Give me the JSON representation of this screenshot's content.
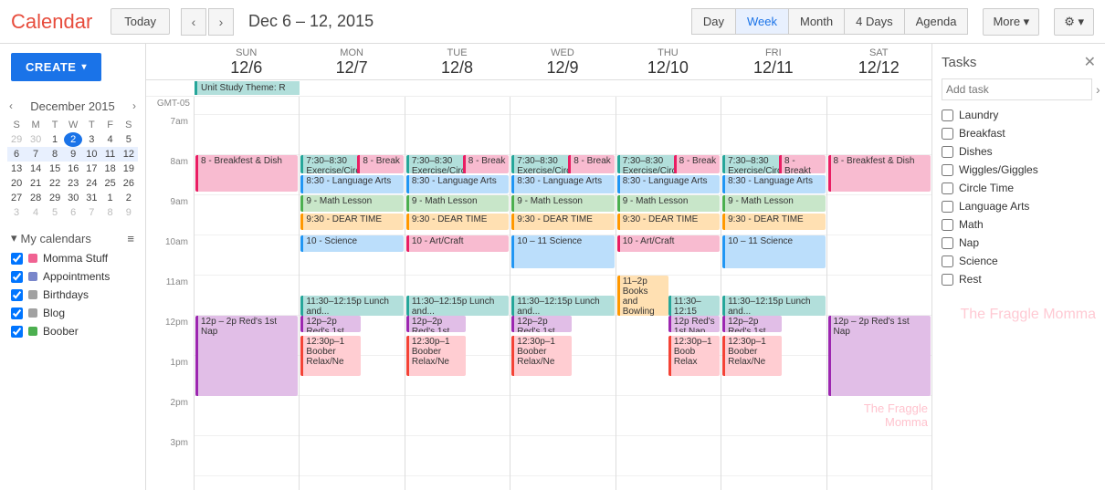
{
  "topbar": {
    "title": "Calendar",
    "today_label": "Today",
    "date_range": "Dec 6 – 12, 2015",
    "nav_prev": "‹",
    "nav_next": "›",
    "views": [
      "Day",
      "Week",
      "Month",
      "4 Days",
      "Agenda"
    ],
    "active_view": "Week",
    "more_label": "More",
    "gear_label": "⚙"
  },
  "sidebar": {
    "create_label": "CREATE",
    "mini_cal": {
      "title": "December 2015",
      "days_header": [
        "S",
        "M",
        "T",
        "W",
        "T",
        "F",
        "S"
      ],
      "weeks": [
        [
          "29",
          "30",
          "1",
          "2",
          "3",
          "4",
          "5"
        ],
        [
          "6",
          "7",
          "8",
          "9",
          "10",
          "11",
          "12"
        ],
        [
          "13",
          "14",
          "15",
          "16",
          "17",
          "18",
          "19"
        ],
        [
          "20",
          "21",
          "22",
          "23",
          "24",
          "25",
          "26"
        ],
        [
          "27",
          "28",
          "29",
          "30",
          "31",
          "1",
          "2"
        ],
        [
          "3",
          "4",
          "5",
          "6",
          "7",
          "8",
          "9"
        ]
      ],
      "today": "2",
      "selected_week": [
        "6",
        "7",
        "8",
        "9",
        "10",
        "11",
        "12"
      ]
    },
    "my_calendars_label": "My calendars",
    "calendars": [
      {
        "name": "Momma Stuff",
        "color": "#f06292"
      },
      {
        "name": "Appointments",
        "color": "#7986cb"
      },
      {
        "name": "Birthdays",
        "color": "#a1a1a1"
      },
      {
        "name": "Blog",
        "color": "#a1a1a1"
      },
      {
        "name": "Boober",
        "color": "#4caf50"
      }
    ]
  },
  "calendar": {
    "gmt_label": "GMT-05",
    "days": [
      {
        "day": "Sun",
        "date": "12/6"
      },
      {
        "day": "Mon",
        "date": "12/7"
      },
      {
        "day": "Tue",
        "date": "12/8"
      },
      {
        "day": "Wed",
        "date": "12/9"
      },
      {
        "day": "Thu",
        "date": "12/10"
      },
      {
        "day": "Fri",
        "date": "12/11"
      },
      {
        "day": "Sat",
        "date": "12/12"
      }
    ],
    "unit_banner": "Unit Study Theme: R",
    "times": [
      "7am",
      "8am",
      "9am",
      "10am",
      "11am",
      "12pm",
      "1pm",
      "2pm",
      "3pm"
    ]
  },
  "tasks": {
    "title": "Tasks",
    "close_label": "✕",
    "arrow_label": "›",
    "items": [
      "Laundry",
      "Breakfast",
      "Dishes",
      "Wiggles/Giggles",
      "Circle Time",
      "Language Arts",
      "Math",
      "Nap",
      "Science",
      "Rest"
    ]
  },
  "watermark": "The Fraggle Momma"
}
